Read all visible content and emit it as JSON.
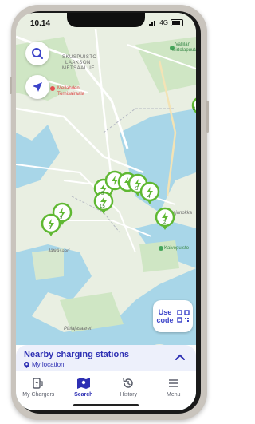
{
  "status": {
    "time": "10.14",
    "network": "4G"
  },
  "map_labels": {
    "district1": "SKUSPUISTO",
    "district2": "LAAKSON",
    "district3": "METSÄALUE",
    "poi_hospital": "Meilahden",
    "poi_hospital2": "Tornisairaala",
    "poi_top_right": "Vallilan",
    "poi_top_right2": "siirtolapuutarha",
    "katajanokka": "Katajanokka",
    "jatkasaari": "Jätkäsaari",
    "kaivopuisto": "Kaivopuisto",
    "pihlajasaaret": "Pihlajasaaret"
  },
  "markers": [
    {
      "count": ""
    },
    {
      "count": "9"
    },
    {
      "count": "5"
    },
    {
      "count": ""
    },
    {
      "count": ""
    },
    {
      "count": "5"
    },
    {
      "count": "4"
    },
    {
      "count": "15"
    },
    {
      "count": "2"
    },
    {
      "count": "2"
    }
  ],
  "use_code": {
    "line1": "Use",
    "line2": "code"
  },
  "nearby": {
    "title": "Nearby charging stations",
    "subtitle": "My location"
  },
  "tabs": [
    {
      "label": "My Chargers",
      "icon": "charger-icon"
    },
    {
      "label": "Search",
      "icon": "map-icon"
    },
    {
      "label": "History",
      "icon": "history-icon"
    },
    {
      "label": "Menu",
      "icon": "menu-icon"
    }
  ],
  "active_tab": "Search",
  "colors": {
    "accent": "#2d2fb3",
    "marker": "#5fb832",
    "water": "#a8d6e8"
  }
}
